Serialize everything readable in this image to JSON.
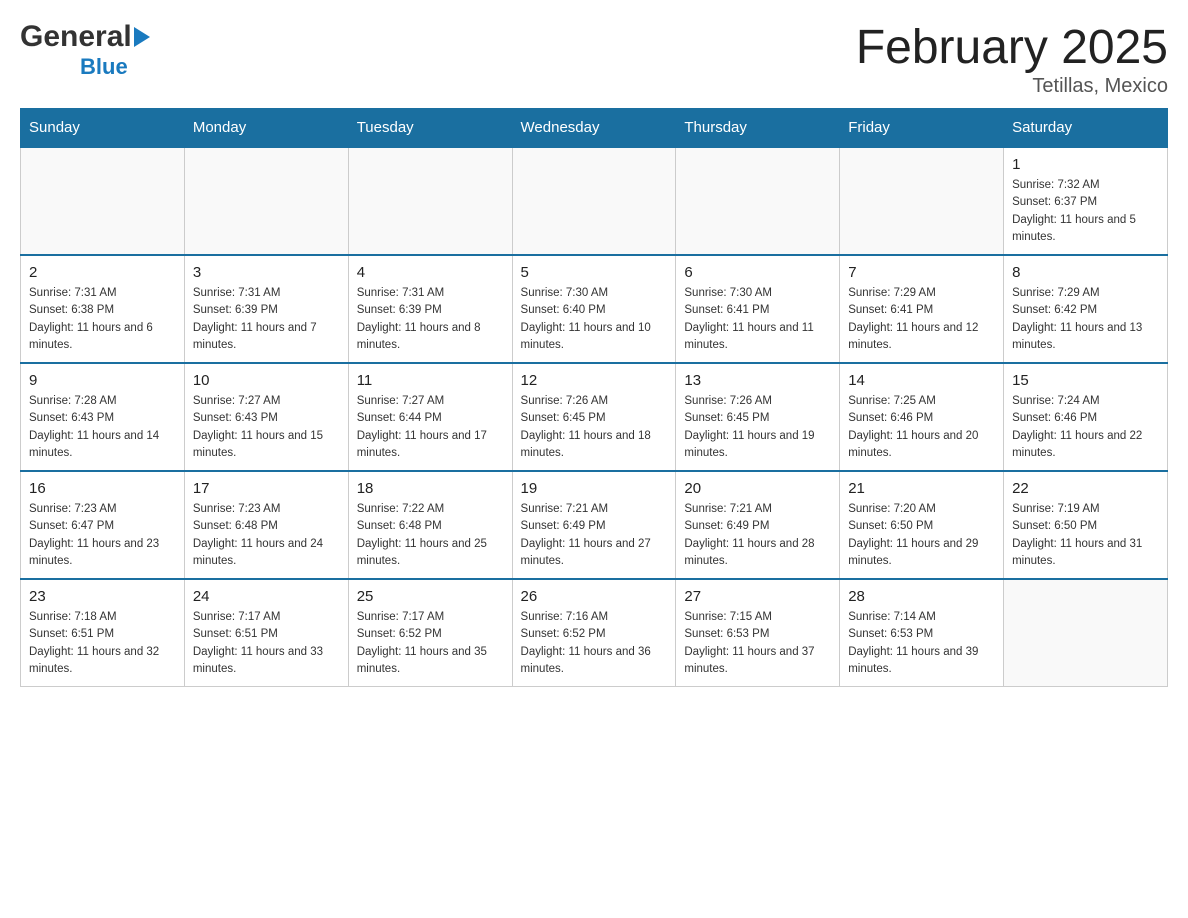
{
  "header": {
    "logo_general": "General",
    "logo_blue": "Blue",
    "month_title": "February 2025",
    "location": "Tetillas, Mexico"
  },
  "weekdays": [
    "Sunday",
    "Monday",
    "Tuesday",
    "Wednesday",
    "Thursday",
    "Friday",
    "Saturday"
  ],
  "weeks": [
    [
      {
        "day": "",
        "info": ""
      },
      {
        "day": "",
        "info": ""
      },
      {
        "day": "",
        "info": ""
      },
      {
        "day": "",
        "info": ""
      },
      {
        "day": "",
        "info": ""
      },
      {
        "day": "",
        "info": ""
      },
      {
        "day": "1",
        "info": "Sunrise: 7:32 AM\nSunset: 6:37 PM\nDaylight: 11 hours and 5 minutes."
      }
    ],
    [
      {
        "day": "2",
        "info": "Sunrise: 7:31 AM\nSunset: 6:38 PM\nDaylight: 11 hours and 6 minutes."
      },
      {
        "day": "3",
        "info": "Sunrise: 7:31 AM\nSunset: 6:39 PM\nDaylight: 11 hours and 7 minutes."
      },
      {
        "day": "4",
        "info": "Sunrise: 7:31 AM\nSunset: 6:39 PM\nDaylight: 11 hours and 8 minutes."
      },
      {
        "day": "5",
        "info": "Sunrise: 7:30 AM\nSunset: 6:40 PM\nDaylight: 11 hours and 10 minutes."
      },
      {
        "day": "6",
        "info": "Sunrise: 7:30 AM\nSunset: 6:41 PM\nDaylight: 11 hours and 11 minutes."
      },
      {
        "day": "7",
        "info": "Sunrise: 7:29 AM\nSunset: 6:41 PM\nDaylight: 11 hours and 12 minutes."
      },
      {
        "day": "8",
        "info": "Sunrise: 7:29 AM\nSunset: 6:42 PM\nDaylight: 11 hours and 13 minutes."
      }
    ],
    [
      {
        "day": "9",
        "info": "Sunrise: 7:28 AM\nSunset: 6:43 PM\nDaylight: 11 hours and 14 minutes."
      },
      {
        "day": "10",
        "info": "Sunrise: 7:27 AM\nSunset: 6:43 PM\nDaylight: 11 hours and 15 minutes."
      },
      {
        "day": "11",
        "info": "Sunrise: 7:27 AM\nSunset: 6:44 PM\nDaylight: 11 hours and 17 minutes."
      },
      {
        "day": "12",
        "info": "Sunrise: 7:26 AM\nSunset: 6:45 PM\nDaylight: 11 hours and 18 minutes."
      },
      {
        "day": "13",
        "info": "Sunrise: 7:26 AM\nSunset: 6:45 PM\nDaylight: 11 hours and 19 minutes."
      },
      {
        "day": "14",
        "info": "Sunrise: 7:25 AM\nSunset: 6:46 PM\nDaylight: 11 hours and 20 minutes."
      },
      {
        "day": "15",
        "info": "Sunrise: 7:24 AM\nSunset: 6:46 PM\nDaylight: 11 hours and 22 minutes."
      }
    ],
    [
      {
        "day": "16",
        "info": "Sunrise: 7:23 AM\nSunset: 6:47 PM\nDaylight: 11 hours and 23 minutes."
      },
      {
        "day": "17",
        "info": "Sunrise: 7:23 AM\nSunset: 6:48 PM\nDaylight: 11 hours and 24 minutes."
      },
      {
        "day": "18",
        "info": "Sunrise: 7:22 AM\nSunset: 6:48 PM\nDaylight: 11 hours and 25 minutes."
      },
      {
        "day": "19",
        "info": "Sunrise: 7:21 AM\nSunset: 6:49 PM\nDaylight: 11 hours and 27 minutes."
      },
      {
        "day": "20",
        "info": "Sunrise: 7:21 AM\nSunset: 6:49 PM\nDaylight: 11 hours and 28 minutes."
      },
      {
        "day": "21",
        "info": "Sunrise: 7:20 AM\nSunset: 6:50 PM\nDaylight: 11 hours and 29 minutes."
      },
      {
        "day": "22",
        "info": "Sunrise: 7:19 AM\nSunset: 6:50 PM\nDaylight: 11 hours and 31 minutes."
      }
    ],
    [
      {
        "day": "23",
        "info": "Sunrise: 7:18 AM\nSunset: 6:51 PM\nDaylight: 11 hours and 32 minutes."
      },
      {
        "day": "24",
        "info": "Sunrise: 7:17 AM\nSunset: 6:51 PM\nDaylight: 11 hours and 33 minutes."
      },
      {
        "day": "25",
        "info": "Sunrise: 7:17 AM\nSunset: 6:52 PM\nDaylight: 11 hours and 35 minutes."
      },
      {
        "day": "26",
        "info": "Sunrise: 7:16 AM\nSunset: 6:52 PM\nDaylight: 11 hours and 36 minutes."
      },
      {
        "day": "27",
        "info": "Sunrise: 7:15 AM\nSunset: 6:53 PM\nDaylight: 11 hours and 37 minutes."
      },
      {
        "day": "28",
        "info": "Sunrise: 7:14 AM\nSunset: 6:53 PM\nDaylight: 11 hours and 39 minutes."
      },
      {
        "day": "",
        "info": ""
      }
    ]
  ]
}
